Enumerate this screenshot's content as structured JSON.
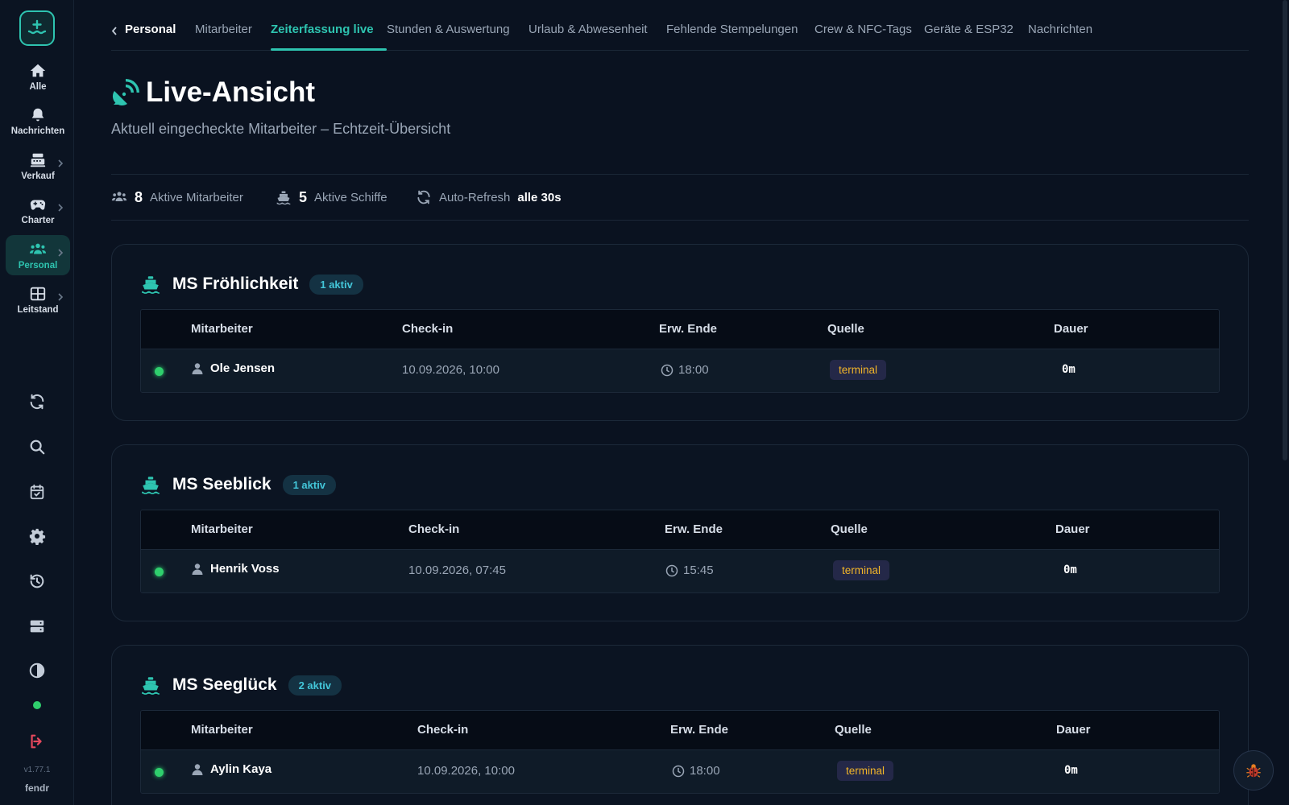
{
  "sidebar": {
    "nav": [
      {
        "label": "Alle",
        "icon": "home-icon"
      },
      {
        "label": "Nachrichten",
        "icon": "bell-icon"
      },
      {
        "label": "Verkauf",
        "icon": "cash-register-icon"
      },
      {
        "label": "Charter",
        "icon": "gamepad-icon"
      },
      {
        "label": "Personal",
        "icon": "users-icon"
      },
      {
        "label": "Leitstand",
        "icon": "grid-icon"
      }
    ],
    "version": "v1.77.1",
    "brand": "fendr"
  },
  "tabs": {
    "parent": "Personal",
    "items": [
      "Mitarbeiter",
      "Zeiterfassung live",
      "Stunden & Auswertung",
      "Urlaub & Abwesenheit",
      "Fehlende Stempelungen",
      "Crew & NFC-Tags",
      "Geräte & ESP32",
      "Nachrichten"
    ],
    "active": "Zeiterfassung live"
  },
  "page": {
    "title": "Live-Ansicht",
    "subtitle": "Aktuell eingecheckte Mitarbeiter – Echtzeit-Übersicht"
  },
  "stats": {
    "employees_count": "8",
    "employees_label": "Aktive Mitarbeiter",
    "ships_count": "5",
    "ships_label": "Aktive Schiffe",
    "refresh_label": "Auto-Refresh",
    "refresh_value": "alle 30s"
  },
  "table_headers": {
    "employee": "Mitarbeiter",
    "checkin": "Check-in",
    "expected_end": "Erw. Ende",
    "source": "Quelle",
    "duration": "Dauer"
  },
  "ships": [
    {
      "name": "MS Fröhlichkeit",
      "badge": "1 aktiv",
      "rows": [
        {
          "employee": "Ole Jensen",
          "checkin": "10.09.2026, 10:00",
          "end": "18:00",
          "source": "terminal",
          "duration": "0m"
        }
      ]
    },
    {
      "name": "MS Seeblick",
      "badge": "1 aktiv",
      "rows": [
        {
          "employee": "Henrik Voss",
          "checkin": "10.09.2026, 07:45",
          "end": "15:45",
          "source": "terminal",
          "duration": "0m"
        }
      ]
    },
    {
      "name": "MS Seeglück",
      "badge": "2 aktiv",
      "rows": [
        {
          "employee": "Aylin Kaya",
          "checkin": "10.09.2026, 10:00",
          "end": "18:00",
          "source": "terminal",
          "duration": "0m"
        }
      ]
    }
  ],
  "colors": {
    "accent": "#2ec4b0",
    "live": "#2fcf6d",
    "source_badge": "#f0b429"
  }
}
